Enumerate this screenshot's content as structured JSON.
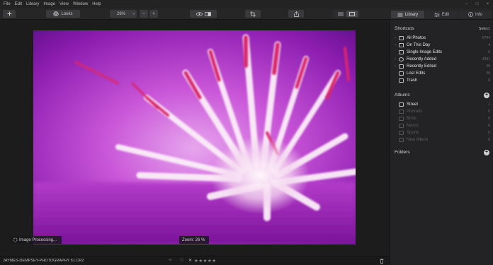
{
  "menu": [
    "File",
    "Edit",
    "Library",
    "Image",
    "View",
    "Window",
    "Help"
  ],
  "window_controls": [
    "–",
    "□",
    "×"
  ],
  "toolbar": {
    "looks_label": "Looks",
    "zoom_value": "26%",
    "zoom_minus": "−",
    "zoom_plus": "+"
  },
  "panels": {
    "library": "Library",
    "edit": "Edit",
    "info": "Info"
  },
  "canvas": {
    "processing_label": "Image Processing...",
    "zoom_label": "Zoom: 26 %"
  },
  "status": {
    "filename": "JAYMES-DEMPSEY-PHOTOGRAPHY 61.CR2",
    "stars": "★★★★★"
  },
  "sidebar": {
    "shortcuts_title": "Shortcuts",
    "select_label": "Select",
    "shortcuts": [
      {
        "label": "All Photos",
        "count": "5744",
        "chevron": "›"
      },
      {
        "label": "On This Day",
        "count": "4",
        "chevron": "›"
      },
      {
        "label": "Single Image Edits",
        "count": "0",
        "chevron": ""
      },
      {
        "label": "Recently Added",
        "count": "4391",
        "chevron": "›"
      },
      {
        "label": "Recently Edited",
        "count": "26",
        "chevron": "›"
      },
      {
        "label": "Lost Edits",
        "count": "25",
        "chevron": ""
      },
      {
        "label": "Trash",
        "count": "0",
        "chevron": ""
      }
    ],
    "albums_title": "Albums",
    "albums": [
      {
        "label": "Street",
        "count": "1",
        "dim": false
      },
      {
        "label": "Portraits",
        "count": "0",
        "dim": true
      },
      {
        "label": "Birds",
        "count": "0",
        "dim": true
      },
      {
        "label": "Macro",
        "count": "0",
        "dim": true
      },
      {
        "label": "Sports",
        "count": "0",
        "dim": true
      },
      {
        "label": "New Album",
        "count": "0",
        "dim": true
      }
    ],
    "folders_title": "Folders"
  }
}
